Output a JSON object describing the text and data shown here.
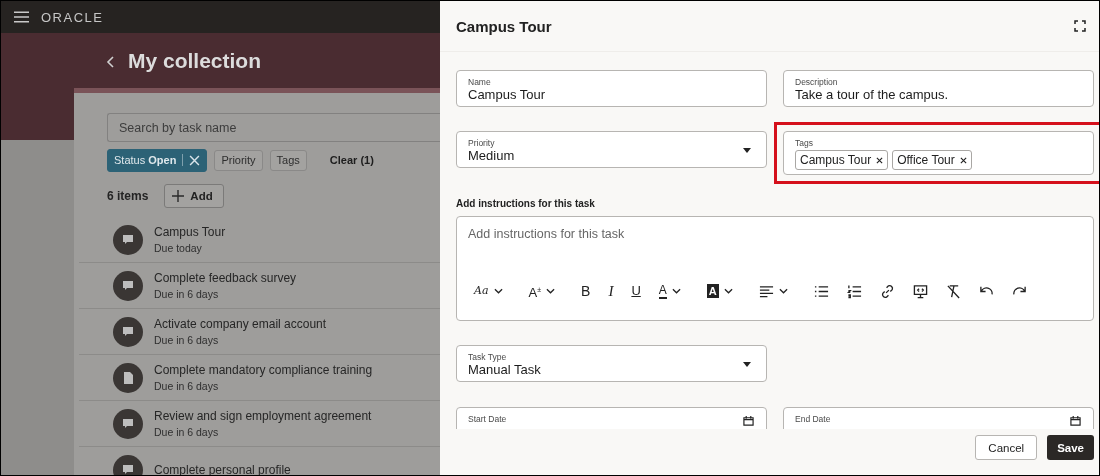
{
  "app_bar": {
    "brand": "ORACLE"
  },
  "page": {
    "title": "My collection",
    "search": {
      "placeholder": "Search by task name"
    },
    "filters": [
      {
        "label": "Status **Open**",
        "active": true
      },
      {
        "label": "Priority",
        "active": false
      },
      {
        "label": "Tags",
        "active": false
      }
    ],
    "clear": "Clear (1)",
    "count": "6 items",
    "add": "Add",
    "tasks": [
      {
        "name": "Campus Tour",
        "due": "Due today",
        "kind": "chat"
      },
      {
        "name": "Complete feedback survey",
        "due": "Due in 6 days",
        "kind": "chat"
      },
      {
        "name": "Activate company email account",
        "due": "Due in 6 days",
        "kind": "chat"
      },
      {
        "name": "Complete mandatory compliance training",
        "due": "Due in 6 days",
        "kind": "document"
      },
      {
        "name": "Review and sign employment agreement",
        "due": "Due in 6 days",
        "kind": "chat"
      },
      {
        "name": "Complete personal profile",
        "kind": "chat"
      }
    ]
  },
  "drawer": {
    "title": "Campus Tour",
    "name": {
      "label": "Name",
      "value": "Campus Tour"
    },
    "description": {
      "label": "Description",
      "value": "Take a tour of the campus."
    },
    "priority": {
      "label": "Priority",
      "value": "Medium"
    },
    "tags": {
      "label": "Tags",
      "highlighted": true,
      "items": [
        "Campus Tour",
        "Office Tour"
      ]
    },
    "instructions": {
      "label": "Add instructions for this task",
      "placeholder": "Add instructions for this task",
      "toolbar": [
        {
          "kind": "font",
          "glyph": "Aa",
          "menu": true
        },
        {
          "kind": "size",
          "glyph": "A$^{±}$",
          "menu": true
        },
        {
          "kind": "bold",
          "glyph": "B",
          "menu": false
        },
        {
          "kind": "italic",
          "glyph": "I",
          "menu": false
        },
        {
          "kind": "underline",
          "glyph": "U",
          "menu": false
        },
        {
          "kind": "color",
          "glyph": "A",
          "menu": true
        },
        {
          "kind": "highlight",
          "glyph": "A",
          "menu": true
        },
        {
          "kind": "align",
          "menu": true
        },
        {
          "kind": "bullets",
          "menu": false
        },
        {
          "kind": "numbers",
          "menu": false
        },
        {
          "kind": "link",
          "menu": false
        },
        {
          "kind": "media",
          "menu": false
        },
        {
          "kind": "clear",
          "menu": false
        },
        {
          "kind": "undo",
          "menu": false
        },
        {
          "kind": "redo",
          "menu": false
        }
      ]
    },
    "task_type": {
      "label": "Task Type",
      "value": "Manual Task"
    },
    "start_date": {
      "label": "Start Date"
    },
    "end_date": {
      "label": "End Date"
    },
    "buttons": {
      "cancel": "Cancel",
      "save": "Save"
    }
  }
}
